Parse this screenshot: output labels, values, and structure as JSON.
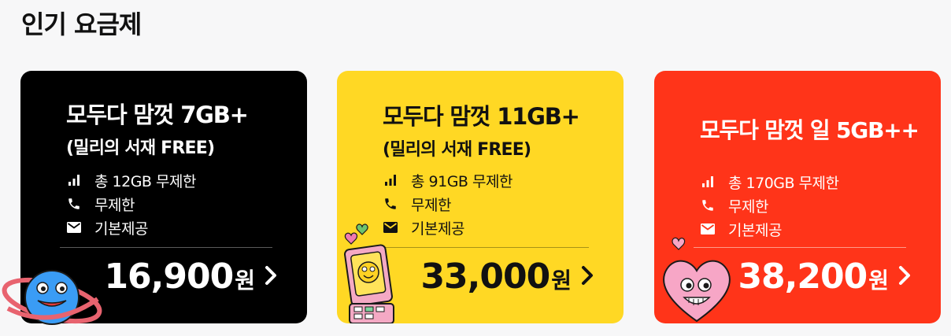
{
  "section": {
    "title": "인기 요금제"
  },
  "plans": [
    {
      "name": "모두다 맘껏 7GB+",
      "subtitle": "(밀리의 서재 FREE)",
      "features": [
        {
          "icon": "signal-icon",
          "text": "총 12GB 무제한"
        },
        {
          "icon": "phone-icon",
          "text": "무제한"
        },
        {
          "icon": "mail-icon",
          "text": "기본제공"
        }
      ],
      "price": "16,900",
      "currency": "원",
      "background": "#000000",
      "text_color": "#ffffff",
      "mascot": "planet-mascot"
    },
    {
      "name": "모두다 맘껏 11GB+",
      "subtitle": "(밀리의 서재 FREE)",
      "features": [
        {
          "icon": "signal-icon",
          "text": "총 91GB 무제한"
        },
        {
          "icon": "phone-icon",
          "text": "무제한"
        },
        {
          "icon": "mail-icon",
          "text": "기본제공"
        }
      ],
      "price": "33,000",
      "currency": "원",
      "background": "#ffd824",
      "text_color": "#111111",
      "mascot": "flip-phone-mascot"
    },
    {
      "name": "모두다 맘껏 일 5GB++",
      "subtitle": "",
      "features": [
        {
          "icon": "signal-icon",
          "text": "총 170GB 무제한"
        },
        {
          "icon": "phone-icon",
          "text": "무제한"
        },
        {
          "icon": "mail-icon",
          "text": "기본제공"
        }
      ],
      "price": "38,200",
      "currency": "원",
      "background": "#ff3419",
      "text_color": "#ffffff",
      "mascot": "heart-mascot"
    }
  ]
}
